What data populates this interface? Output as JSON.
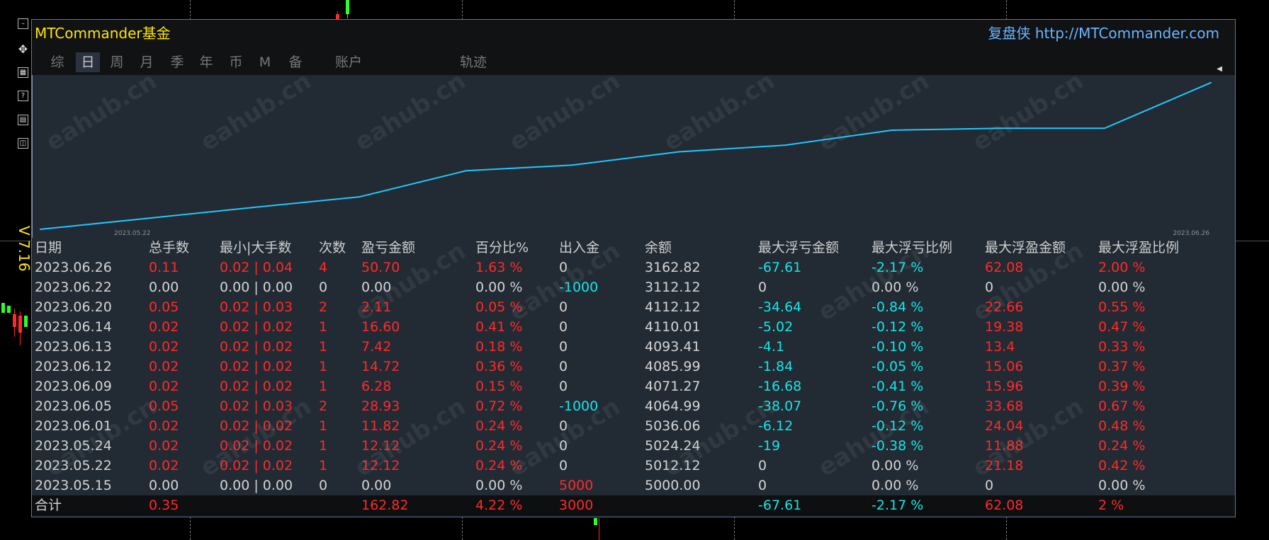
{
  "app": {
    "title": "MTCommander基金",
    "brand": "复盘侠 http://MTCommander.com",
    "version": "V 7.16",
    "watermark": "eahub.cn"
  },
  "tools": [
    {
      "name": "minimize-icon",
      "glyph": "–"
    },
    {
      "name": "move-icon",
      "glyph": "✥"
    },
    {
      "name": "calendar-icon",
      "glyph": "▦"
    },
    {
      "name": "help-icon",
      "glyph": "?"
    },
    {
      "name": "table-icon",
      "glyph": "▤"
    },
    {
      "name": "window-icon",
      "glyph": "◫"
    }
  ],
  "tabs": [
    {
      "label": "综",
      "active": false
    },
    {
      "label": "日",
      "active": true
    },
    {
      "label": "周",
      "active": false
    },
    {
      "label": "月",
      "active": false
    },
    {
      "label": "季",
      "active": false
    },
    {
      "label": "年",
      "active": false
    },
    {
      "label": "币",
      "active": false
    },
    {
      "label": "M",
      "active": false
    },
    {
      "label": "备",
      "active": false
    },
    {
      "label": "账户",
      "active": false
    },
    {
      "label": "轨迹",
      "active": false
    }
  ],
  "colors": {
    "line": "#1ec8ff",
    "positive": "#ff2a2a",
    "negative": "#14e6e6",
    "neutral": "#d4d4d4",
    "accent": "#ffe600",
    "brand": "#6ab6ff"
  },
  "chart_data": {
    "type": "line",
    "x": [
      "2023.05.15",
      "2023.05.22",
      "2023.05.24",
      "2023.06.01",
      "2023.06.05",
      "2023.06.09",
      "2023.06.12",
      "2023.06.13",
      "2023.06.14",
      "2023.06.20",
      "2023.06.22",
      "2023.06.26"
    ],
    "values": [
      5000.0,
      5012.12,
      5024.24,
      5036.06,
      5064.99,
      5071.27,
      5085.99,
      5093.41,
      5110.01,
      5112.12,
      5112.12,
      5162.82
    ],
    "x_start_label": "2023.05.22",
    "x_end_label": "2023.06.26",
    "ylim": [
      5000,
      5165
    ],
    "grid": false,
    "legend": "none"
  },
  "table": {
    "headers": [
      "日期",
      "总手数",
      "最小|大手数",
      "次数",
      "盈亏金额",
      "百分比%",
      "出入金",
      "余额",
      "最大浮亏金额",
      "最大浮亏比例",
      "最大浮盈金额",
      "最大浮盈比例"
    ],
    "rows": [
      [
        "2023.06.26",
        "0.11",
        "0.02 | 0.04",
        "4",
        "50.70",
        "1.63 %",
        "0",
        "3162.82",
        "-67.61",
        "-2.17 %",
        "62.08",
        "2.00 %"
      ],
      [
        "2023.06.22",
        "0.00",
        "0.00 | 0.00",
        "0",
        "0.00",
        "0.00 %",
        "-1000",
        "3112.12",
        "0",
        "0.00 %",
        "0",
        "0.00 %"
      ],
      [
        "2023.06.20",
        "0.05",
        "0.02 | 0.03",
        "2",
        "2.11",
        "0.05 %",
        "0",
        "4112.12",
        "-34.64",
        "-0.84 %",
        "22.66",
        "0.55 %"
      ],
      [
        "2023.06.14",
        "0.02",
        "0.02 | 0.02",
        "1",
        "16.60",
        "0.41 %",
        "0",
        "4110.01",
        "-5.02",
        "-0.12 %",
        "19.38",
        "0.47 %"
      ],
      [
        "2023.06.13",
        "0.02",
        "0.02 | 0.02",
        "1",
        "7.42",
        "0.18 %",
        "0",
        "4093.41",
        "-4.1",
        "-0.10 %",
        "13.4",
        "0.33 %"
      ],
      [
        "2023.06.12",
        "0.02",
        "0.02 | 0.02",
        "1",
        "14.72",
        "0.36 %",
        "0",
        "4085.99",
        "-1.84",
        "-0.05 %",
        "15.06",
        "0.37 %"
      ],
      [
        "2023.06.09",
        "0.02",
        "0.02 | 0.02",
        "1",
        "6.28",
        "0.15 %",
        "0",
        "4071.27",
        "-16.68",
        "-0.41 %",
        "15.96",
        "0.39 %"
      ],
      [
        "2023.06.05",
        "0.05",
        "0.02 | 0.03",
        "2",
        "28.93",
        "0.72 %",
        "-1000",
        "4064.99",
        "-38.07",
        "-0.76 %",
        "33.68",
        "0.67 %"
      ],
      [
        "2023.06.01",
        "0.02",
        "0.02 | 0.02",
        "1",
        "11.82",
        "0.24 %",
        "0",
        "5036.06",
        "-6.12",
        "-0.12 %",
        "24.04",
        "0.48 %"
      ],
      [
        "2023.05.24",
        "0.02",
        "0.02 | 0.02",
        "1",
        "12.12",
        "0.24 %",
        "0",
        "5024.24",
        "-19",
        "-0.38 %",
        "11.88",
        "0.24 %"
      ],
      [
        "2023.05.22",
        "0.02",
        "0.02 | 0.02",
        "1",
        "12.12",
        "0.24 %",
        "0",
        "5012.12",
        "0",
        "0.00 %",
        "21.18",
        "0.42 %"
      ],
      [
        "2023.05.15",
        "0.00",
        "0.00 | 0.00",
        "0",
        "0.00",
        "0.00 %",
        "5000",
        "5000.00",
        "0",
        "0.00 %",
        "0",
        "0.00 %"
      ]
    ],
    "row_colors": [
      [
        "white",
        "red",
        "red",
        "red",
        "red",
        "red",
        "white",
        "white",
        "cyan",
        "cyan",
        "red",
        "red"
      ],
      [
        "white",
        "white",
        "white",
        "white",
        "white",
        "white",
        "cyan",
        "white",
        "white",
        "white",
        "white",
        "white"
      ],
      [
        "white",
        "red",
        "red",
        "red",
        "red",
        "red",
        "white",
        "white",
        "cyan",
        "cyan",
        "red",
        "red"
      ],
      [
        "white",
        "red",
        "red",
        "red",
        "red",
        "red",
        "white",
        "white",
        "cyan",
        "cyan",
        "red",
        "red"
      ],
      [
        "white",
        "red",
        "red",
        "red",
        "red",
        "red",
        "white",
        "white",
        "cyan",
        "cyan",
        "red",
        "red"
      ],
      [
        "white",
        "red",
        "red",
        "red",
        "red",
        "red",
        "white",
        "white",
        "cyan",
        "cyan",
        "red",
        "red"
      ],
      [
        "white",
        "red",
        "red",
        "red",
        "red",
        "red",
        "white",
        "white",
        "cyan",
        "cyan",
        "red",
        "red"
      ],
      [
        "white",
        "red",
        "red",
        "red",
        "red",
        "red",
        "cyan",
        "white",
        "cyan",
        "cyan",
        "red",
        "red"
      ],
      [
        "white",
        "red",
        "red",
        "red",
        "red",
        "red",
        "white",
        "white",
        "cyan",
        "cyan",
        "red",
        "red"
      ],
      [
        "white",
        "red",
        "red",
        "red",
        "red",
        "red",
        "white",
        "white",
        "cyan",
        "cyan",
        "red",
        "red"
      ],
      [
        "white",
        "red",
        "red",
        "red",
        "red",
        "red",
        "white",
        "white",
        "white",
        "white",
        "red",
        "red"
      ],
      [
        "white",
        "white",
        "white",
        "white",
        "white",
        "white",
        "red",
        "white",
        "white",
        "white",
        "white",
        "white"
      ]
    ],
    "total": [
      "合计",
      "0.35",
      "",
      "",
      "162.82",
      "4.22 %",
      "3000",
      "",
      "-67.61",
      "-2.17 %",
      "62.08",
      "2 %"
    ],
    "total_colors": [
      "white",
      "red",
      "white",
      "white",
      "red",
      "red",
      "red",
      "white",
      "cyan",
      "cyan",
      "red",
      "red"
    ]
  }
}
